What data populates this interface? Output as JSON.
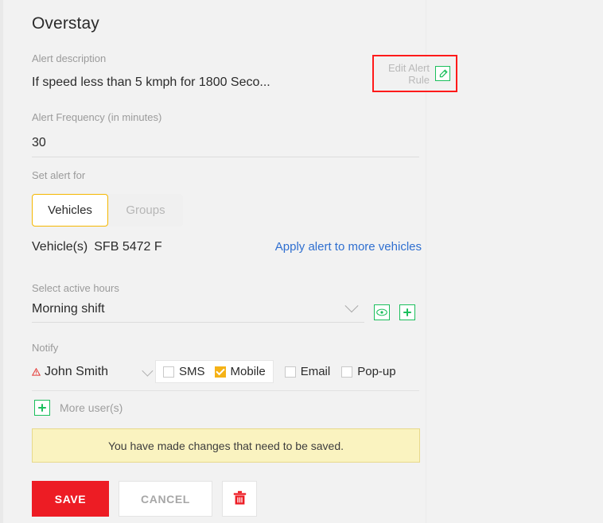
{
  "panel": {
    "title": "Overstay"
  },
  "alert_description": {
    "label": "Alert description",
    "text": "If speed less than 5 kmph for 1800 Seco..."
  },
  "edit_alert_rule": {
    "label": "Edit Alert Rule",
    "icon": "pencil-icon",
    "highlight_color": "#ff1a1a",
    "accent_color": "#1bbf5c"
  },
  "alert_frequency": {
    "label": "Alert Frequency (in minutes)",
    "value": "30",
    "placeholder": "Enter minutes"
  },
  "set_alert_for": {
    "label": "Set alert for",
    "options": [
      {
        "label": "Vehicles",
        "selected": true
      },
      {
        "label": "Groups",
        "selected": false
      }
    ],
    "selected_color": "#f5b700"
  },
  "vehicles": {
    "label": "Vehicle(s)",
    "value": "SFB 5472 F",
    "apply_link": "Apply alert to more vehicles",
    "link_color": "#2f6fd0"
  },
  "active_hours": {
    "label": "Select active hours",
    "value": "Morning shift",
    "view_icon": "eye-icon",
    "add_icon": "plus-icon"
  },
  "notify": {
    "label": "Notify",
    "user": "John Smith",
    "user_warning_icon": "warning-triangle-icon",
    "channels": [
      {
        "label": "SMS",
        "checked": false,
        "grouped": true
      },
      {
        "label": "Mobile",
        "checked": true,
        "grouped": true
      },
      {
        "label": "Email",
        "checked": false,
        "grouped": false
      },
      {
        "label": "Pop-up",
        "checked": false,
        "grouped": false
      }
    ],
    "checked_color": "#f5b216"
  },
  "more_users": {
    "label": "More user(s)",
    "icon": "plus-icon"
  },
  "banner": {
    "message": "You have made changes that need to be saved.",
    "background": "#faf3c0",
    "border": "#e8d98b"
  },
  "actions": {
    "save_label": "SAVE",
    "save_color": "#ed1c24",
    "cancel_label": "CANCEL",
    "delete_icon": "trash-icon",
    "delete_color": "#ed1c24"
  }
}
